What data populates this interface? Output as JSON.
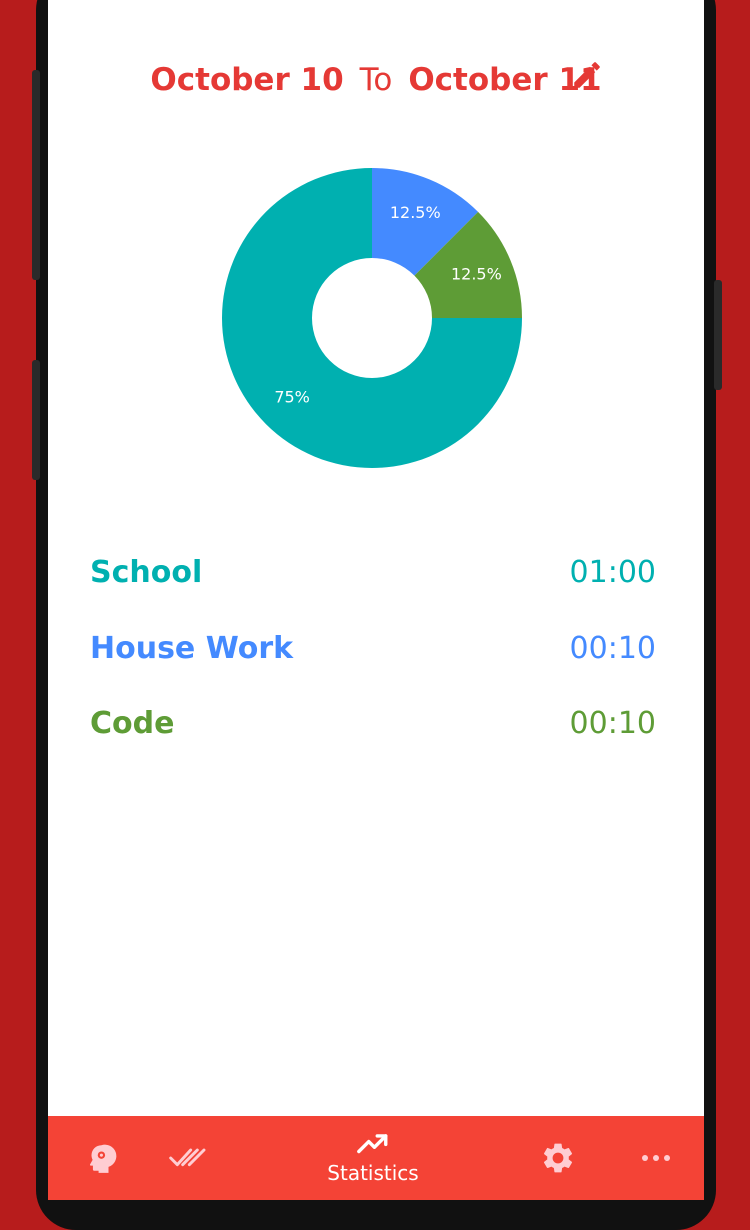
{
  "header": {
    "from_date": "October 10",
    "separator": "To",
    "to_date": "October 11",
    "edit_icon": "pencil-icon"
  },
  "colors": {
    "accent": "#e53935",
    "nav_background": "#f44336",
    "school": "#00b0b0",
    "house_work": "#448aff",
    "code": "#5e9c36"
  },
  "chart_data": {
    "type": "pie",
    "donut": true,
    "slices": [
      {
        "name": "House Work",
        "value": 12.5,
        "label": "12.5%",
        "color": "#448aff"
      },
      {
        "name": "Code",
        "value": 12.5,
        "label": "12.5%",
        "color": "#5e9c36"
      },
      {
        "name": "School",
        "value": 75,
        "label": "75%",
        "color": "#00b0b0"
      }
    ]
  },
  "legend": [
    {
      "name": "School",
      "time": "01:00",
      "color": "#00b0b0"
    },
    {
      "name": "House Work",
      "time": "00:10",
      "color": "#448aff"
    },
    {
      "name": "Code",
      "time": "00:10",
      "color": "#5e9c36"
    }
  ],
  "bottom_nav": {
    "items": [
      {
        "icon": "head-profile-icon",
        "label": ""
      },
      {
        "icon": "double-check-icon",
        "label": ""
      },
      {
        "icon": "trending-up-icon",
        "label": "Statistics",
        "active": true
      },
      {
        "icon": "gear-icon",
        "label": ""
      },
      {
        "icon": "more-horizontal-icon",
        "label": ""
      }
    ]
  }
}
